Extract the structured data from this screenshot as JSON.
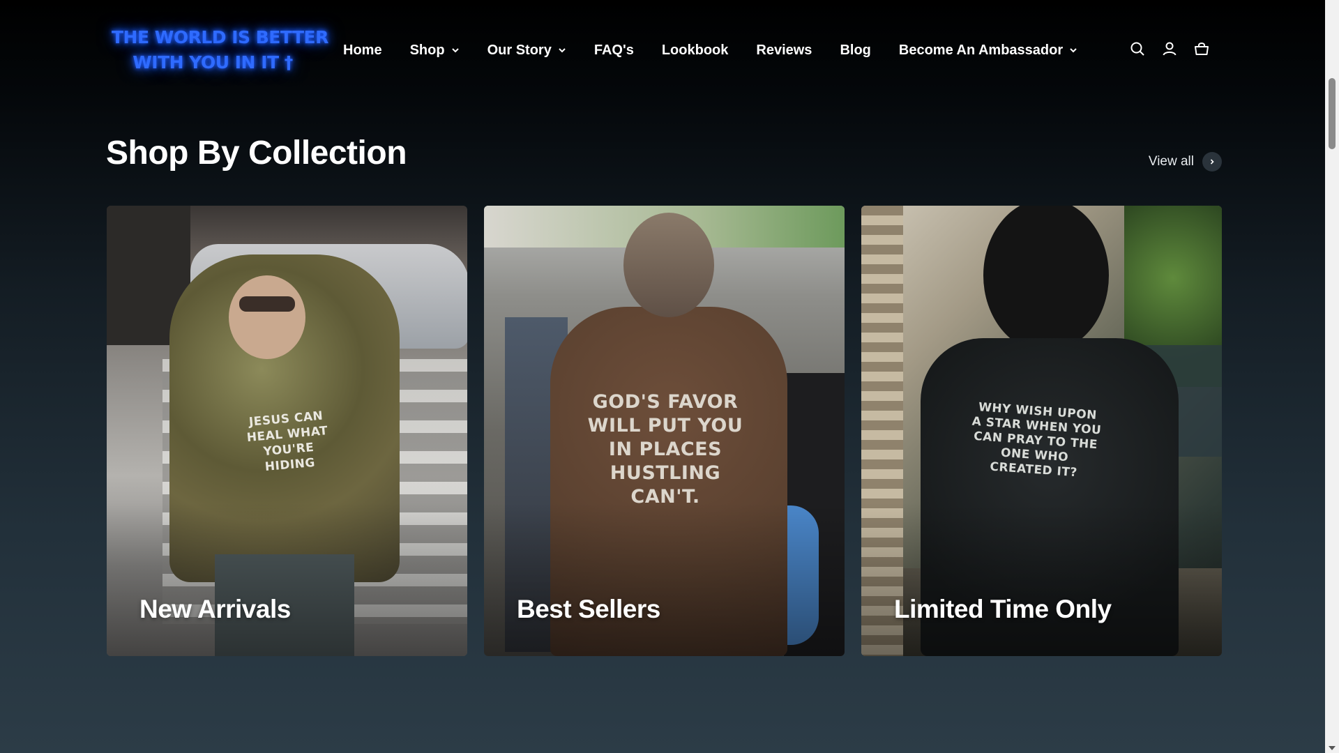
{
  "header": {
    "logo_line1": "THE WORLD IS BETTER",
    "logo_line2": "WITH YOU IN IT  †",
    "nav": [
      {
        "label": "Home",
        "has_dropdown": false
      },
      {
        "label": "Shop",
        "has_dropdown": true
      },
      {
        "label": "Our Story",
        "has_dropdown": true
      },
      {
        "label": "FAQ's",
        "has_dropdown": false
      },
      {
        "label": "Lookbook",
        "has_dropdown": false
      },
      {
        "label": "Reviews",
        "has_dropdown": false
      },
      {
        "label": "Blog",
        "has_dropdown": false
      },
      {
        "label": "Become An Ambassador",
        "has_dropdown": true
      }
    ],
    "icons": [
      "search-icon",
      "account-icon",
      "cart-icon"
    ]
  },
  "section": {
    "title": "Shop By Collection",
    "view_all": "View all"
  },
  "collections": [
    {
      "label": "New Arrivals",
      "shirt_text": "JESUS CAN HEAL WHAT YOU'RE HIDING"
    },
    {
      "label": "Best Sellers",
      "shirt_text": "GOD'S FAVOR WILL PUT YOU IN PLACES HUSTLING CAN'T."
    },
    {
      "label": "Limited Time Only",
      "shirt_text": "WHY WISH UPON A STAR WHEN YOU CAN PRAY TO THE ONE WHO CREATED IT?"
    }
  ],
  "colors": {
    "accent_logo": "#2f6bff",
    "background_top": "#000000",
    "background_bottom": "#2c3c47"
  }
}
